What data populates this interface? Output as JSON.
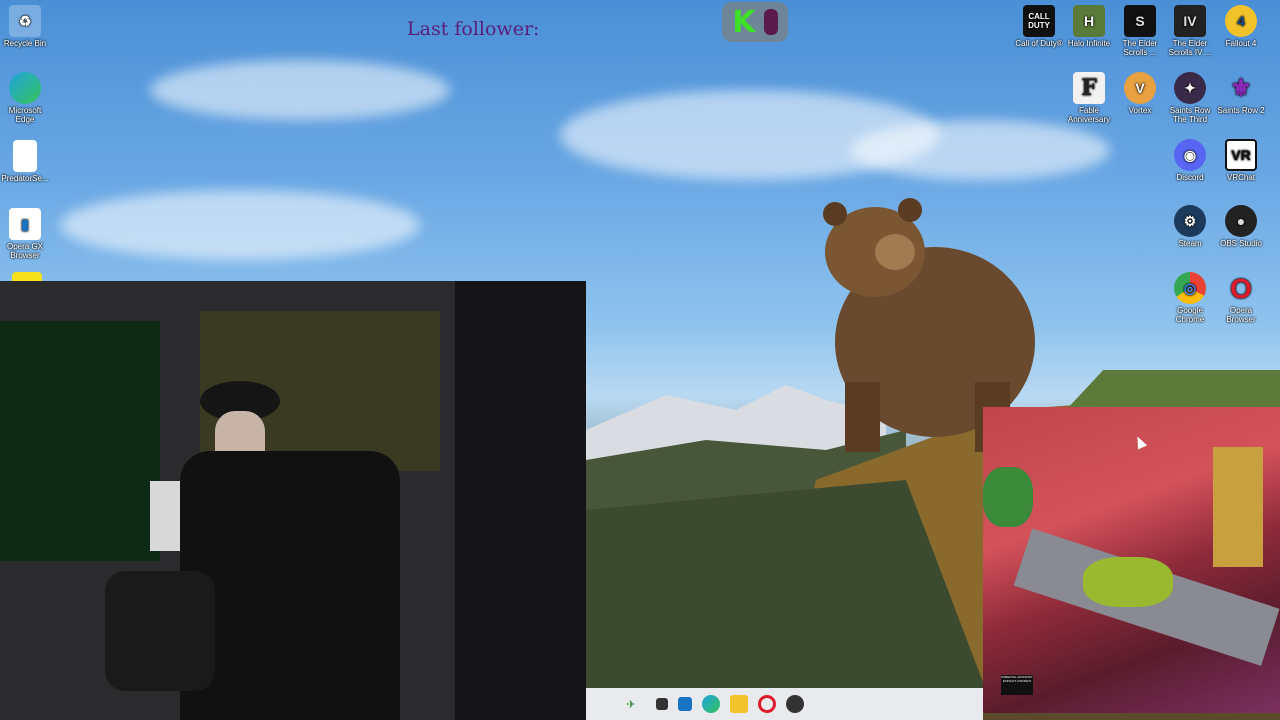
{
  "overlay": {
    "follower_label": "Last follower:",
    "counter_letter": "K",
    "counter_value": "0"
  },
  "desktop_left": [
    {
      "label": "Recycle Bin",
      "icon": "recycle-bin-icon"
    },
    {
      "label": "Microsoft Edge",
      "icon": "edge-icon"
    },
    {
      "label": "PredatorSe...",
      "icon": "file-icon"
    },
    {
      "label": "Opera GX Browser",
      "icon": "opera-gx-icon"
    }
  ],
  "desktop_right": [
    {
      "label": "Call of Duty®",
      "icon": "call-of-duty-icon",
      "glyph": "CALL DUTY"
    },
    {
      "label": "Halo Infinite",
      "icon": "halo-icon",
      "glyph": "H"
    },
    {
      "label": "The Elder Scrolls ...",
      "icon": "elder-scrolls-icon",
      "glyph": "S"
    },
    {
      "label": "The Elder Scrolls IV ...",
      "icon": "elder-scrolls-iv-icon",
      "glyph": "IV"
    },
    {
      "label": "Fallout 4",
      "icon": "fallout-icon",
      "glyph": "4"
    },
    {
      "label": "Fable Anniversary",
      "icon": "fable-icon",
      "glyph": "F"
    },
    {
      "label": "Vortex",
      "icon": "vortex-icon",
      "glyph": "V"
    },
    {
      "label": "Saints Row The Third",
      "icon": "saints-row-3-icon",
      "glyph": "✦"
    },
    {
      "label": "Saints Row 2",
      "icon": "saints-row-2-icon",
      "glyph": "⚜"
    },
    {
      "label": "Discord",
      "icon": "discord-icon",
      "glyph": "◉"
    },
    {
      "label": "VRChat",
      "icon": "vrchat-icon",
      "glyph": "VR"
    },
    {
      "label": "Steam",
      "icon": "steam-icon",
      "glyph": "⚙"
    },
    {
      "label": "OBS Studio",
      "icon": "obs-icon",
      "glyph": "●"
    },
    {
      "label": "Google Chrome",
      "icon": "chrome-icon",
      "glyph": "◎"
    },
    {
      "label": "Opera Browser",
      "icon": "opera-icon",
      "glyph": "O"
    }
  ],
  "album": {
    "advisory": "PARENTAL ADVISORY EXPLICIT CONTENT"
  },
  "taskbar": [
    {
      "icon": "start-icon"
    },
    {
      "icon": "taskview-icon"
    },
    {
      "icon": "widgets-icon"
    },
    {
      "icon": "edge-icon"
    },
    {
      "icon": "file-explorer-icon"
    },
    {
      "icon": "opera-icon"
    },
    {
      "icon": "obs-icon"
    }
  ]
}
